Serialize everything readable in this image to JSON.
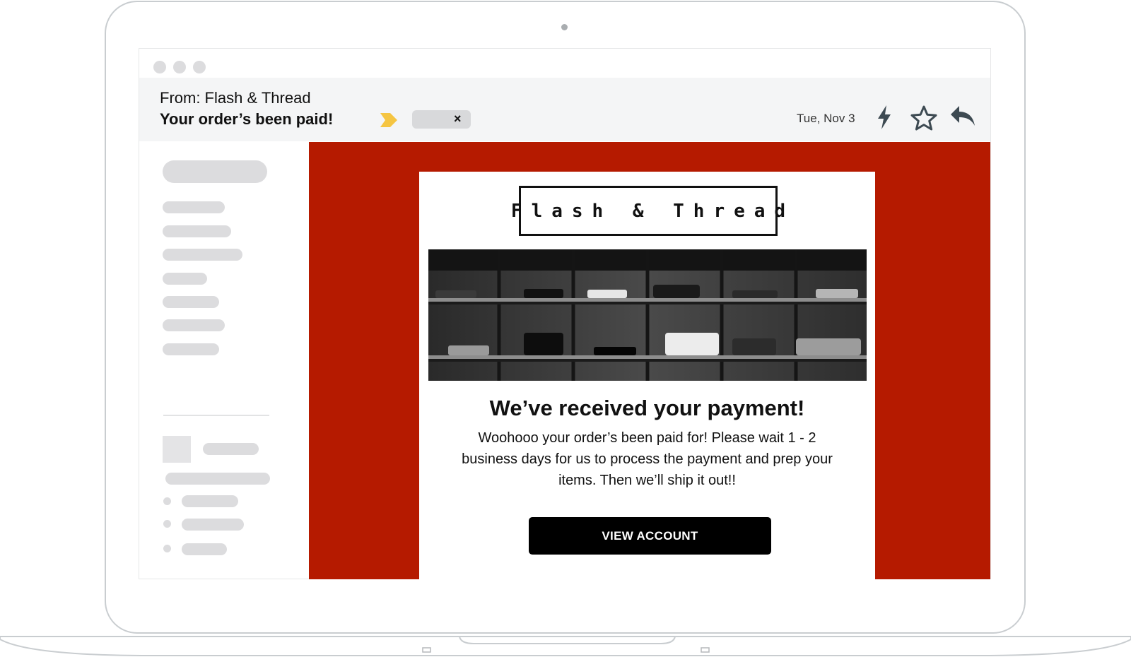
{
  "email": {
    "from": "From: Flash & Thread",
    "subject": "Your order’s been paid!",
    "date": "Tue, Nov 3"
  },
  "icons": {
    "tag": "tag-arrow-icon",
    "remove_tag": "close-icon",
    "quick_action": "lightning-icon",
    "star": "star-icon",
    "reply": "reply-icon"
  },
  "tag_close_glyph": "×",
  "message": {
    "logo": "Flash & Thread",
    "headline": "We’ve received your payment!",
    "body": "Woohooo your order’s been paid for! Please wait 1 - 2 business days for us to process the payment and prep your items. Then we’ll ship it out!!",
    "cta_label": "VIEW ACCOUNT"
  },
  "colors": {
    "email_background": "#b51a00",
    "button": "#000000",
    "tag_accent": "#f5c542"
  }
}
